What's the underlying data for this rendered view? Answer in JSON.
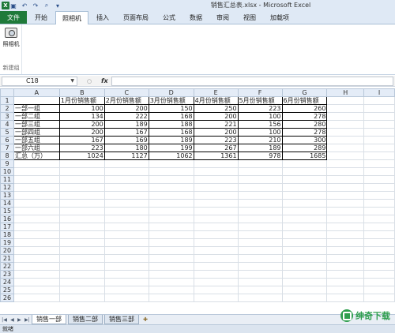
{
  "window": {
    "title": "销售汇总表.xlsx - Microsoft Excel"
  },
  "quick_access": [
    {
      "icon": "excel-logo-icon",
      "glyph": "X"
    },
    {
      "icon": "save-icon",
      "glyph": "💾"
    },
    {
      "icon": "undo-icon",
      "glyph": "↶"
    },
    {
      "icon": "redo-icon",
      "glyph": "↷"
    },
    {
      "icon": "print-preview-icon",
      "glyph": "🔍"
    }
  ],
  "ribbon_tabs": [
    "文件",
    "开始",
    "照相机",
    "插入",
    "页面布局",
    "公式",
    "数据",
    "审阅",
    "视图",
    "加载项"
  ],
  "ribbon": {
    "camera_label": "照相机",
    "group_label": "新建组"
  },
  "formula_bar": {
    "name_box": "C18",
    "fx_label": "fx",
    "formula": ""
  },
  "columns": [
    "A",
    "B",
    "C",
    "D",
    "E",
    "F",
    "G",
    "H",
    "I"
  ],
  "rows": [
    [
      "",
      "1月份销售额",
      "2月份销售额",
      "3月份销售额",
      "4月份销售额",
      "5月份销售额",
      "6月份销售额",
      "",
      ""
    ],
    [
      "一部一组",
      "100",
      "200",
      "150",
      "250",
      "223",
      "260",
      "",
      ""
    ],
    [
      "一部二组",
      "134",
      "222",
      "168",
      "200",
      "100",
      "278",
      "",
      ""
    ],
    [
      "一部三组",
      "200",
      "189",
      "188",
      "221",
      "156",
      "280",
      "",
      ""
    ],
    [
      "一部四组",
      "200",
      "167",
      "168",
      "200",
      "100",
      "278",
      "",
      ""
    ],
    [
      "一部五组",
      "167",
      "169",
      "189",
      "223",
      "210",
      "300",
      "",
      ""
    ],
    [
      "一部六组",
      "223",
      "180",
      "199",
      "267",
      "189",
      "289",
      "",
      ""
    ],
    [
      "汇总（万）",
      "1024",
      "1127",
      "1062",
      "1361",
      "978",
      "1685",
      "",
      ""
    ]
  ],
  "total_rows": 26,
  "sheet_tabs": [
    "销售一部",
    "销售二部",
    "销售三部"
  ],
  "active_sheet": 0,
  "status": "就绪",
  "watermark": "绅奇下载"
}
